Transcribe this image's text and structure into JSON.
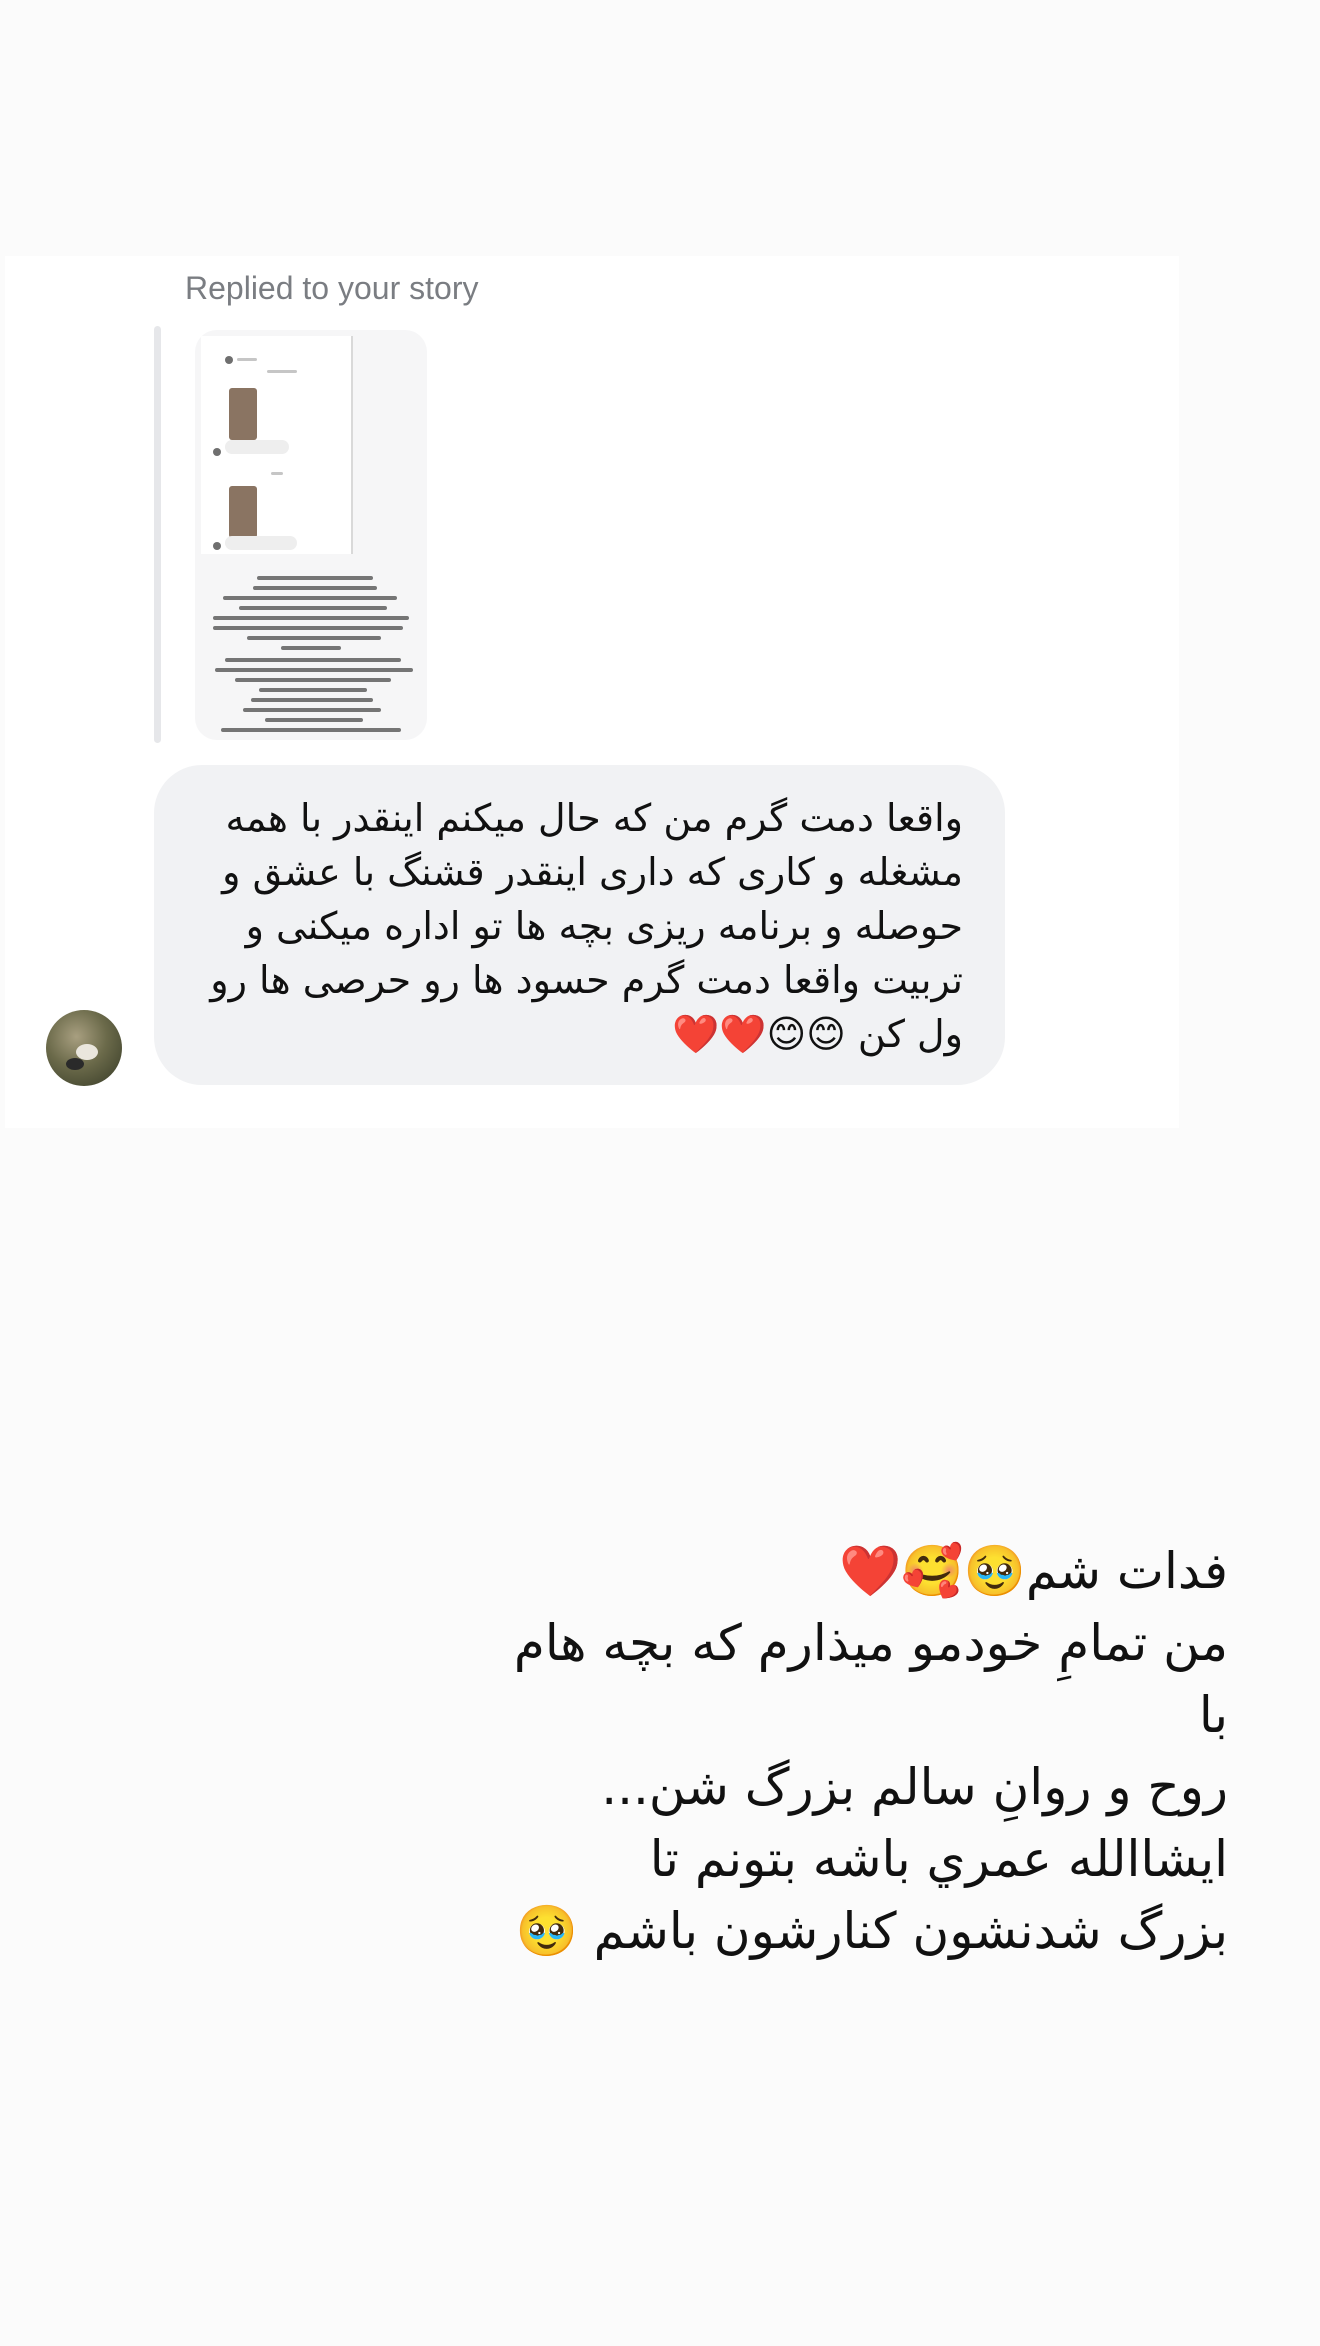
{
  "story_reply": {
    "label": "Replied to your story"
  },
  "message": {
    "text": "واقعا دمت گرم من که حال میکنم اینقدر با همه\nمشغله و کاری که داری اینقدر قشنگ با عشق و\nحوصله و برنامه ریزی بچه ها تو اداره میکنی و\nتربیت واقعا دمت گرم حسود ها رو حرصی ها رو\nول کن 😊😊❤️❤️"
  },
  "caption": {
    "text": "فدات شم🥹🥰❤️\nمن تمامِ خودمو میذارم که بچه هام با\nروح و روانِ سالم بزرگ شن...\nایشاالله عمري باشه بتونم تا\nبزرگ شدنشون کنارشون باشم 🥹"
  },
  "colors": {
    "background": "#fbfbfb",
    "panel": "#ffffff",
    "bubble": "#f1f2f4",
    "muted_text": "#7a7d82"
  },
  "icons": {
    "avatar": "profile-photo",
    "story_preview": "story-thumbnail"
  }
}
